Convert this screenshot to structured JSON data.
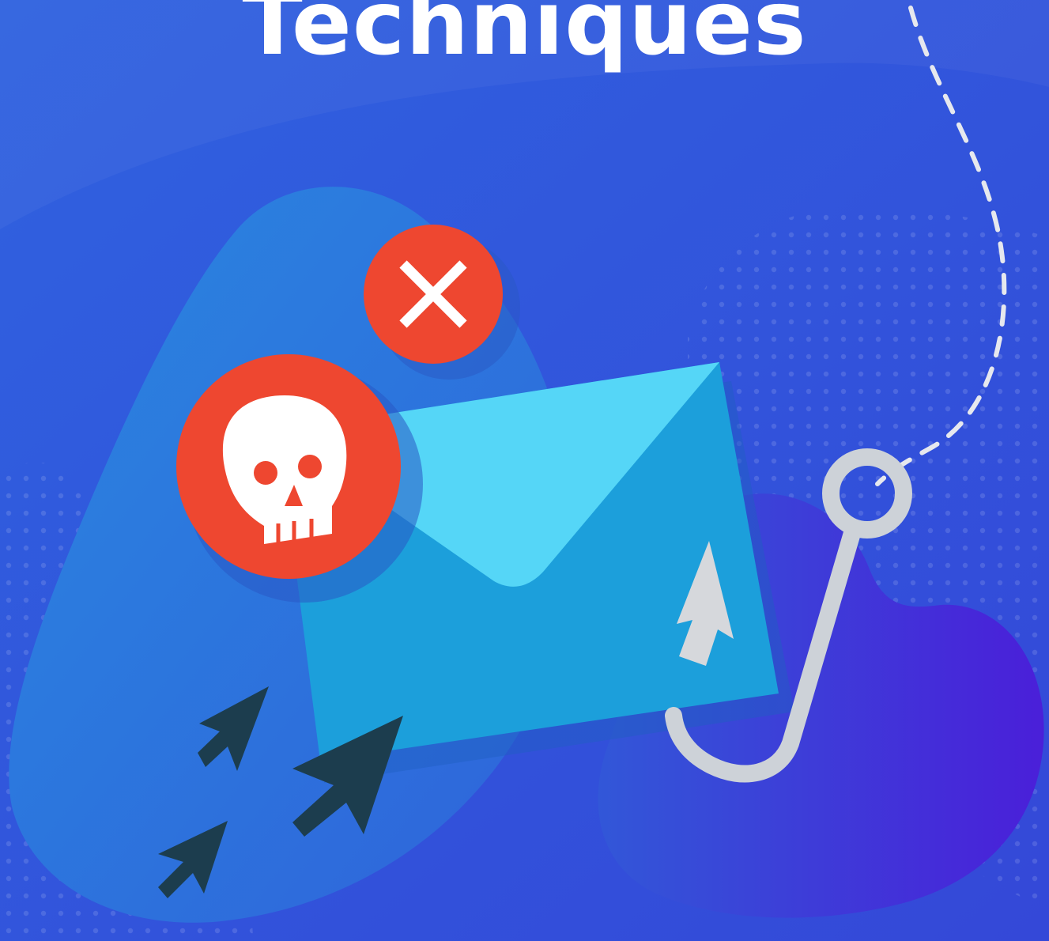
{
  "headline": "Techniques",
  "palette": {
    "background_top": "#2f62df",
    "background_bottom": "#3448d8",
    "blob_left": "#2a7fe0",
    "blob_right": "#4a1fd9",
    "envelope_body": "#1c9fdb",
    "envelope_flap": "#55d6f7",
    "danger_red": "#ee4730",
    "cursor_dark": "#1c3d4e",
    "hook_gray": "#cdd2d8",
    "fishing_line": "#e6e8ee"
  },
  "illustration": {
    "envelope": "envelope-icon",
    "warning_badge": "skull-icon",
    "reject_badge": "close-icon",
    "fishing_hook": "fishing-hook-icon",
    "cursors": [
      "cursor-arrow-icon",
      "cursor-arrow-icon",
      "cursor-arrow-icon",
      "cursor-arrow-icon"
    ]
  }
}
